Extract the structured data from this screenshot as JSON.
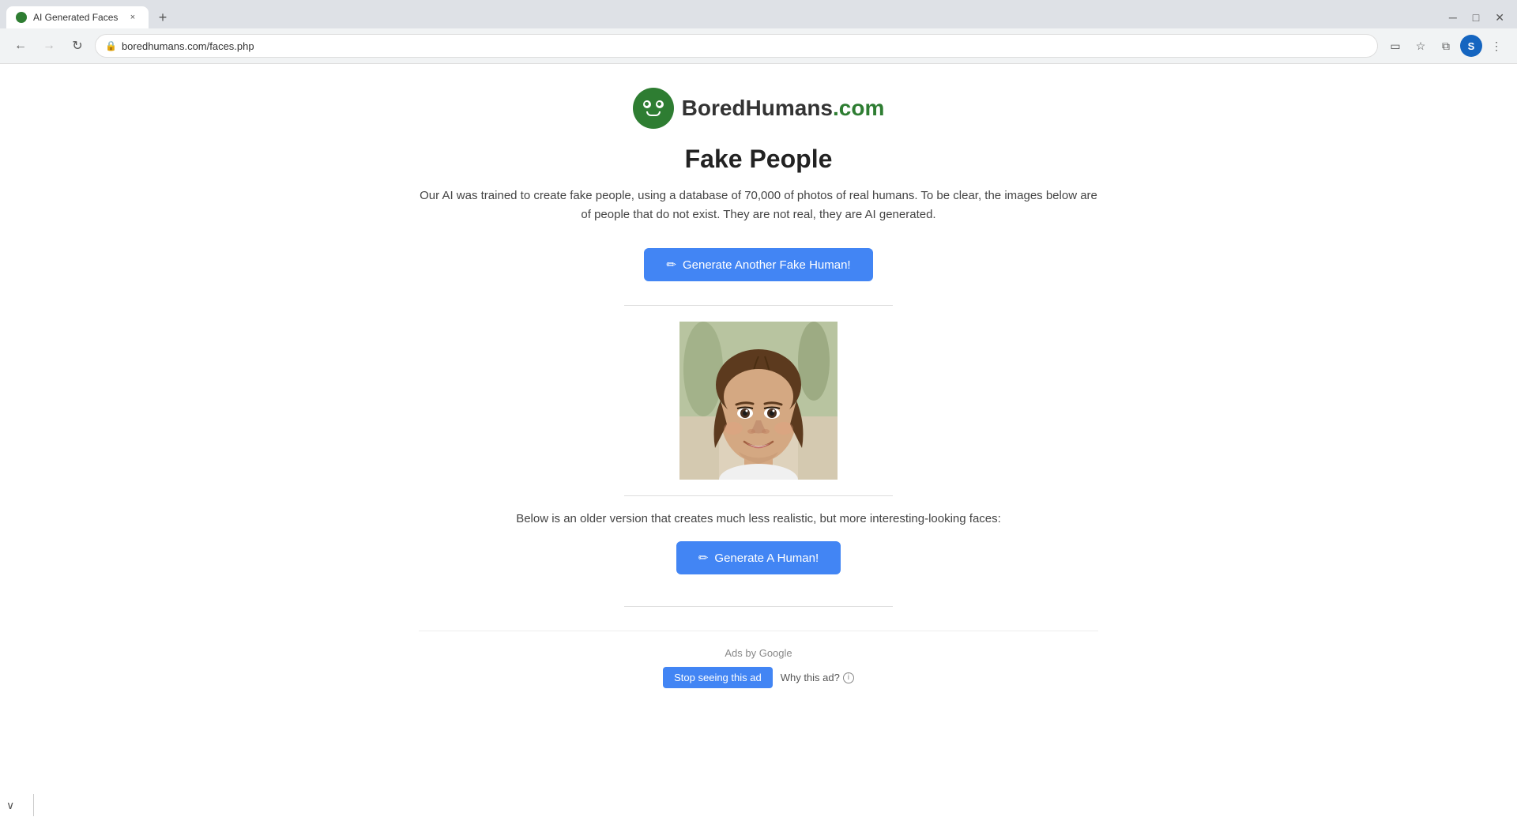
{
  "tab": {
    "title": "AI Generated Faces",
    "favicon_alt": "site-favicon"
  },
  "browser": {
    "url": "boredhumans.com/faces.php",
    "back_disabled": false,
    "forward_disabled": false
  },
  "logo": {
    "brand": "BoredHumans",
    "bored_part": "BoredHumans",
    "dotcom": ".com"
  },
  "page": {
    "title": "Fake People",
    "description": "Our AI was trained to create fake people, using a database of 70,000 of photos of real humans. To be clear, the images below are of people that do not exist. They are not real, they are AI generated.",
    "generate_button": "Generate Another Fake Human!",
    "older_version_text": "Below is an older version that creates much less realistic, but more interesting-looking faces:",
    "generate_human_button": "Generate A Human!"
  },
  "ads": {
    "label": "Ads by Google",
    "stop_button": "Stop seeing this ad",
    "why_button": "Why this ad?"
  },
  "icons": {
    "pencil": "✏",
    "lock": "🔒",
    "chevron_down": "⌄",
    "left_arrow": "←",
    "right_arrow": "→",
    "reload": "↻",
    "extensions": "⬛",
    "star": "☆",
    "profile": "S",
    "menu": "⋮",
    "close": "×",
    "new_tab": "+",
    "down_chevron": "∨",
    "info": "i"
  }
}
